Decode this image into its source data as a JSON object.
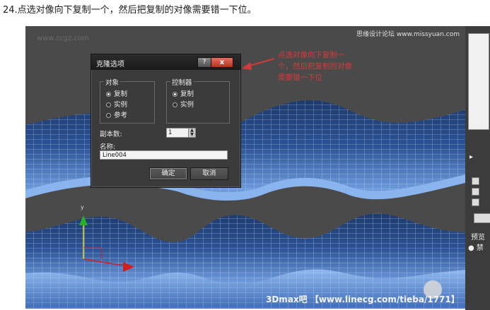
{
  "caption": "24.点选对像向下复制一个，然后把复制的对像需要错一下位。",
  "viewport": {
    "watermark": "www.zcgz.com",
    "corner_text": "思缘设计论坛  www.missyuan.com",
    "axis_y_label": "y",
    "footer_brand": "3Dmax吧 【www.linecg.com/tieba/1771】"
  },
  "annotation": {
    "text": "点选对像向下复制一个，然后把复制的对像需要错一下位",
    "color": "#d23b3b"
  },
  "dialog": {
    "title": "克隆选项",
    "help_label": "?",
    "close_label": "x",
    "object_group": {
      "legend": "对象",
      "options": [
        {
          "label": "复制",
          "selected": true
        },
        {
          "label": "实例",
          "selected": false
        },
        {
          "label": "参考",
          "selected": false
        }
      ]
    },
    "controller_group": {
      "legend": "控制器",
      "options": [
        {
          "label": "复制",
          "selected": true
        },
        {
          "label": "实例",
          "selected": false
        }
      ]
    },
    "copies_label": "副本数:",
    "copies_value": "1",
    "name_label": "名称:",
    "name_value": "Line004",
    "ok_label": "确定",
    "cancel_label": "取消"
  },
  "side_panel": {
    "pin_label": "▸",
    "preview_label": "预览",
    "radio_label": "禁"
  },
  "colors": {
    "viewport_bg": "#4a4a4a",
    "mesh_blue": "#4f7fc5",
    "dialog_bg": "#3b3b3b",
    "close_red": "#c2402a"
  }
}
